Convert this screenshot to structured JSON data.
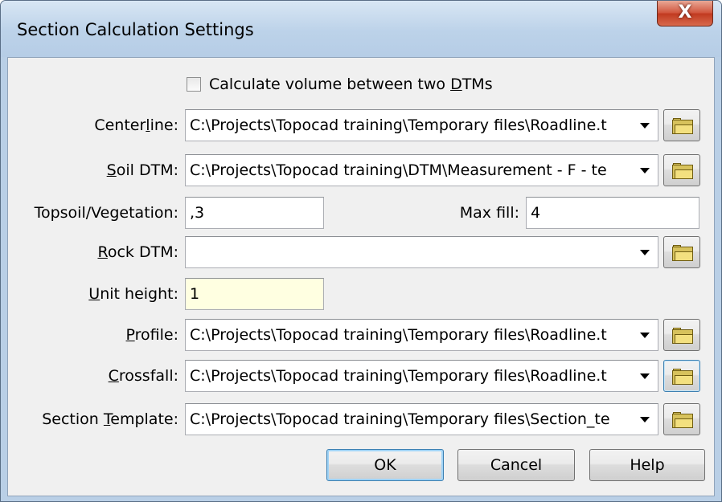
{
  "window": {
    "title": "Section Calculation Settings",
    "close_glyph": "X"
  },
  "checkbox": {
    "label_pre": "Calculate volume between two ",
    "label_u": "D",
    "label_post": "TMs",
    "checked": false
  },
  "fields": {
    "centerline": {
      "label_pre": "Center",
      "label_u": "l",
      "label_post": "ine:",
      "value": "C:\\Projects\\Topocad training\\Temporary files\\Roadline.t"
    },
    "soil_dtm": {
      "label_pre": "",
      "label_u": "S",
      "label_post": "oil DTM:",
      "value": "C:\\Projects\\Topocad training\\DTM\\Measurement - F - te"
    },
    "topsoil": {
      "label": "Topsoil/Vegetation:",
      "value": ",3"
    },
    "max_fill": {
      "label": "Max fill:",
      "value": "4"
    },
    "rock_dtm": {
      "label_pre": "",
      "label_u": "R",
      "label_post": "ock DTM:",
      "value": ""
    },
    "unit_height": {
      "label_pre": "",
      "label_u": "U",
      "label_post": "nit height:",
      "value": "1"
    },
    "profile": {
      "label_pre": "",
      "label_u": "P",
      "label_post": "rofile:",
      "value": "C:\\Projects\\Topocad training\\Temporary files\\Roadline.t"
    },
    "crossfall": {
      "label_pre": "",
      "label_u": "C",
      "label_post": "rossfall:",
      "value": "C:\\Projects\\Topocad training\\Temporary files\\Roadline.t"
    },
    "section_template": {
      "label_pre": "Section ",
      "label_u": "T",
      "label_post": "emplate:",
      "value": "C:\\Projects\\Topocad training\\Temporary files\\Section_te"
    }
  },
  "buttons": {
    "ok": "OK",
    "cancel": "Cancel",
    "help": "Help"
  },
  "icons": {
    "browse": "folder-icon",
    "dropdown": "chevron-down-icon"
  },
  "colors": {
    "title_bar": "#bcd2e9",
    "close": "#c0391f",
    "unit_height_bg": "#ffffe1",
    "dialog_bg": "#f0f0f0"
  }
}
